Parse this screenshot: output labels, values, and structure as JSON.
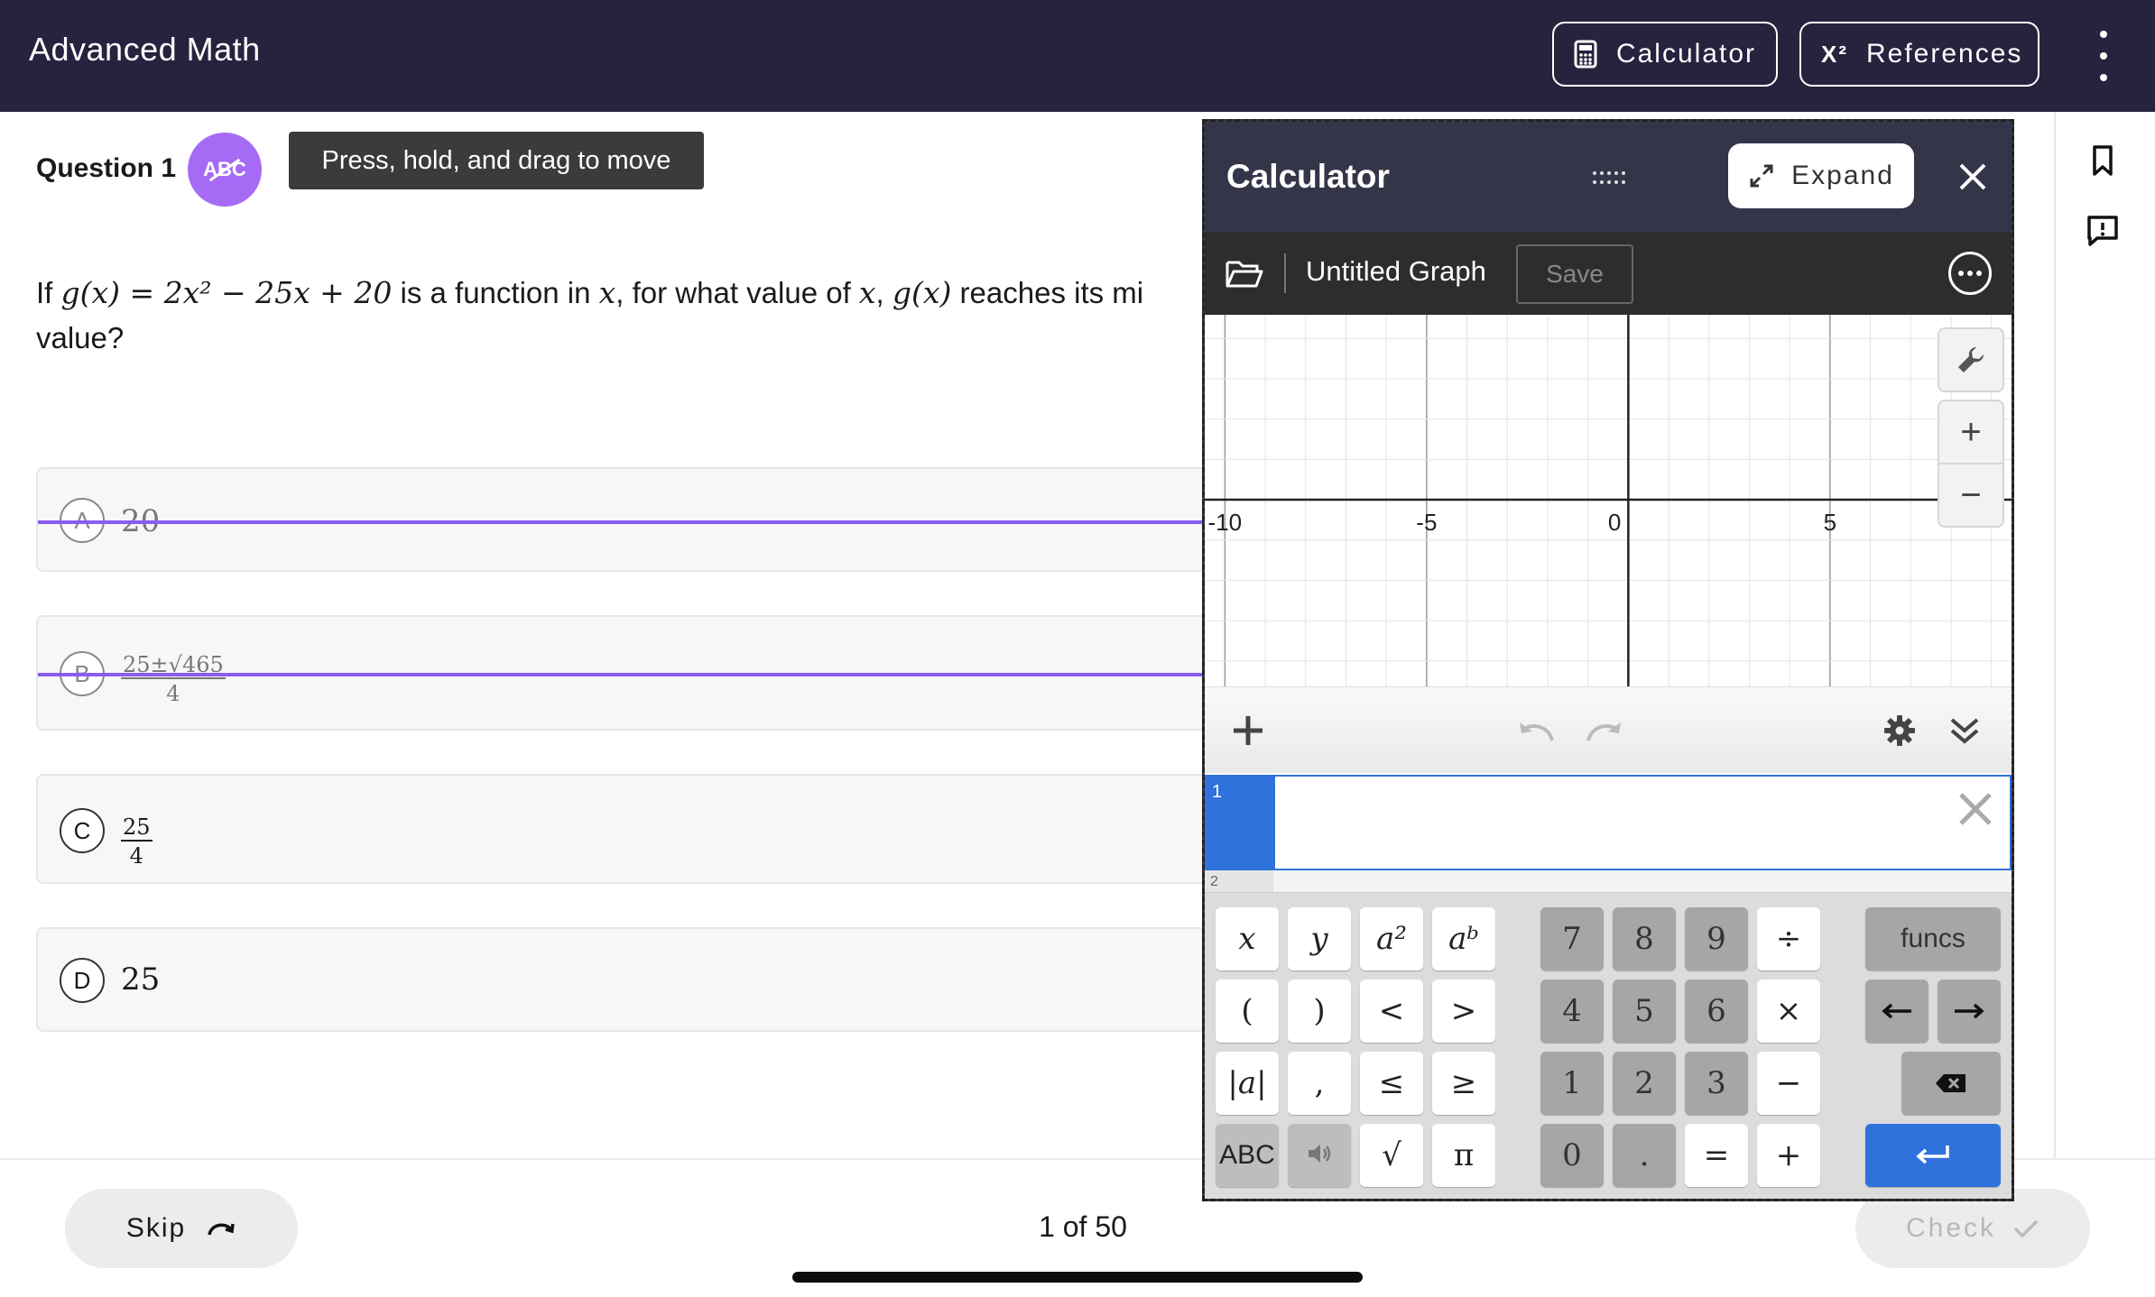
{
  "header": {
    "title": "Advanced Math",
    "calculator_label": "Calculator",
    "references_label": "References",
    "references_icon_text": "X²"
  },
  "question": {
    "label": "Question 1",
    "abc_badge": "ABC",
    "tooltip": "Press, hold, and drag to move",
    "text_prefix": "If",
    "formula": "g(x) = 2x² − 25x + 20",
    "text_mid1": "is a function in",
    "var_x": "x",
    "text_mid2": ", for what value of",
    "text_mid3": ",",
    "gx": "g(x)",
    "text_end_line1": "reaches its mi",
    "text_line2": "value?"
  },
  "choices": [
    {
      "letter": "A",
      "value": "20",
      "eliminated": true
    },
    {
      "letter": "B",
      "numerator": "25±√465",
      "denominator": "4",
      "eliminated": true
    },
    {
      "letter": "C",
      "numerator": "25",
      "denominator": "4",
      "eliminated": false
    },
    {
      "letter": "D",
      "value": "25",
      "eliminated": false
    }
  ],
  "calculator": {
    "title": "Calculator",
    "expand_label": "Expand",
    "graph_title": "Untitled Graph",
    "save_label": "Save",
    "axis_labels": [
      "-10",
      "-5",
      "0",
      "5"
    ],
    "x_range": [
      -10.5,
      9.5
    ],
    "expressions": [
      {
        "number": "1",
        "value": ""
      },
      {
        "number": "2",
        "value": ""
      }
    ],
    "keys": {
      "row1_left": [
        "x",
        "y",
        "a²",
        "aᵇ"
      ],
      "row2_left": [
        "(",
        ")",
        "<",
        ">"
      ],
      "row3_left": [
        "|a|",
        ",",
        "≤",
        "≥"
      ],
      "row4_left": [
        "ABC",
        "",
        "√",
        "π"
      ],
      "row1_num": [
        "7",
        "8",
        "9",
        "÷"
      ],
      "row2_num": [
        "4",
        "5",
        "6",
        "×"
      ],
      "row3_num": [
        "1",
        "2",
        "3",
        "−"
      ],
      "row4_num": [
        "0",
        ".",
        "=",
        "+"
      ],
      "funcs": "funcs"
    }
  },
  "footer": {
    "skip_label": "Skip",
    "page_count": "1 of 50",
    "check_label": "Check"
  }
}
